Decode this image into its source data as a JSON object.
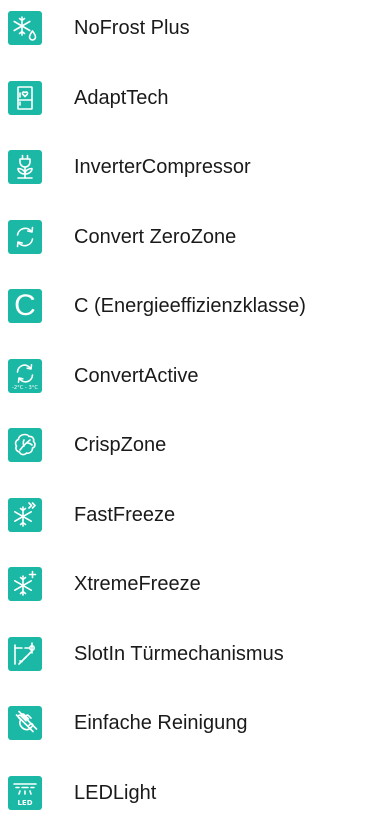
{
  "features": [
    {
      "icon": "snowflake-drop-icon",
      "label": "NoFrost Plus"
    },
    {
      "icon": "fridge-heart-icon",
      "label": "AdaptTech"
    },
    {
      "icon": "plug-leaf-icon",
      "label": "InverterCompressor"
    },
    {
      "icon": "convert-arrows-icon",
      "label": "Convert ZeroZone"
    },
    {
      "icon": "energy-class-c-icon",
      "label": "C (Energieeffizienzklasse)"
    },
    {
      "icon": "convert-temperature-icon",
      "label": "ConvertActive",
      "icon_text": "-2°C - 3°C"
    },
    {
      "icon": "lettuce-icon",
      "label": "CrispZone"
    },
    {
      "icon": "snowflake-fast-icon",
      "label": "FastFreeze"
    },
    {
      "icon": "snowflake-plus-icon",
      "label": "XtremeFreeze"
    },
    {
      "icon": "door-hinge-icon",
      "label": "SlotIn Türmechanismus"
    },
    {
      "icon": "hand-wipe-icon",
      "label": "Einfache Reinigung"
    },
    {
      "icon": "led-light-icon",
      "label": "LEDLight",
      "icon_text": "LED"
    }
  ],
  "colors": {
    "icon_background": "#1ab8a5",
    "icon_foreground": "#ffffff",
    "label_text": "#1a1a1a"
  }
}
